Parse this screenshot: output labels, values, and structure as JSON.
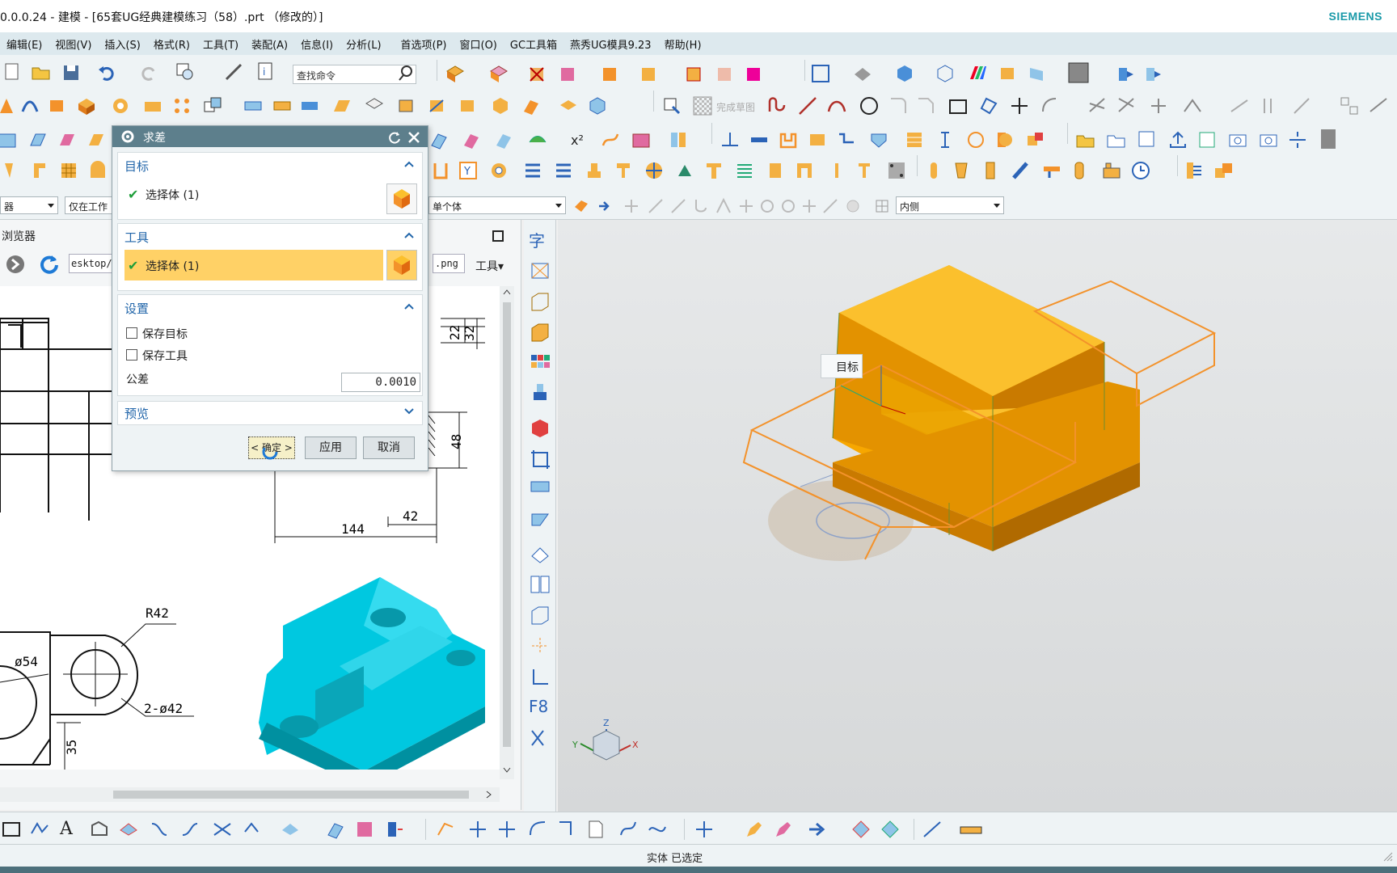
{
  "window": {
    "title": "0.0.0.24 - 建模 - [65套UG经典建模练习（58）.prt （修改的）]",
    "brand": "SIEMENS"
  },
  "menu": [
    "编辑(E)",
    "视图(V)",
    "插入(S)",
    "格式(R)",
    "工具(T)",
    "装配(A)",
    "信息(I)",
    "分析(L)",
    "首选项(P)",
    "窗口(O)",
    "GC工具箱",
    "燕秀UG模具9.23",
    "帮助(H)"
  ],
  "toolbar": {
    "search_placeholder": "查找命令",
    "finish_sketch": "完成草图",
    "superscript": "x²",
    "f8": "F8",
    "zi": "字"
  },
  "selection_bar": {
    "filter_value": "器",
    "scope_value": "仅在工作",
    "body_value": "单个体",
    "side_value": "内侧"
  },
  "browser": {
    "title": "浏览器",
    "address": "esktop/",
    "address_ext": ".png",
    "tools": "工具"
  },
  "dialog": {
    "title": "求差",
    "target_group": "目标",
    "target_selection": "选择体 (1)",
    "tool_group": "工具",
    "tool_selection": "选择体 (1)",
    "settings_group": "设置",
    "keep_target": "保存目标",
    "keep_tool": "保存工具",
    "tolerance_label": "公差",
    "tolerance_value": "0.0010",
    "preview_group": "预览",
    "ok": "< 确定 >",
    "apply": "应用",
    "cancel": "取消"
  },
  "drawing": {
    "dims": [
      "22",
      "32",
      "48",
      "42",
      "144",
      "R42",
      "ø54",
      "2-ø42",
      "35"
    ]
  },
  "viewport": {
    "tooltip": "目标",
    "axis_x": "X",
    "axis_y": "Y",
    "axis_z": "Z"
  },
  "status": {
    "text": "实体 已选定"
  },
  "colors": {
    "accent": "#5d7f8c",
    "selection_highlight": "#ffd166",
    "solid_orange": "#f7a700",
    "preview_orange": "#f3922b",
    "cyan_model": "#00c8e0"
  }
}
